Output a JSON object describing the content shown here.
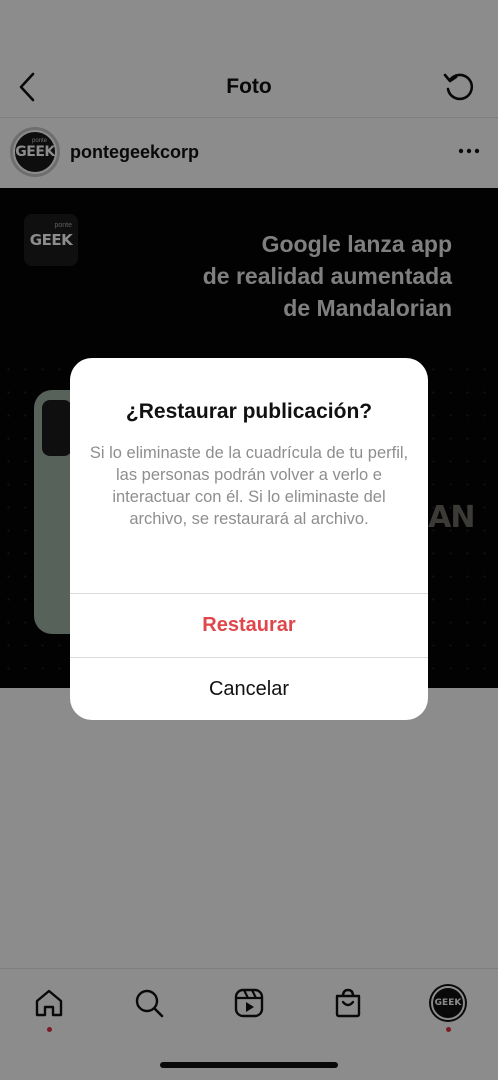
{
  "header": {
    "title": "Foto"
  },
  "profile": {
    "username": "pontegeekcorp",
    "avatar_text": "GEEK",
    "avatar_small": "ponte"
  },
  "post": {
    "logo_text": "GEEK",
    "logo_small": "ponte",
    "headline": [
      "Google lanza app",
      "de realidad aumentada",
      "de Mandalorian"
    ],
    "partial_text": "IAN"
  },
  "dialog": {
    "title": "¿Restaurar publicación?",
    "message": "Si lo eliminaste de la cuadrícula de tu perfil, las personas podrán volver a verlo e interactuar con él. Si lo eliminaste del archivo, se restaurará al archivo.",
    "restore_label": "Restaurar",
    "cancel_label": "Cancelar"
  },
  "nav": {
    "items": [
      {
        "icon": "home-icon"
      },
      {
        "icon": "search-icon"
      },
      {
        "icon": "reels-icon"
      },
      {
        "icon": "shop-icon"
      },
      {
        "icon": "profile-avatar",
        "avatar_text": "GEEK"
      }
    ]
  },
  "colors": {
    "accent_red": "#e0474c",
    "notification_dot": "#e0343f"
  }
}
